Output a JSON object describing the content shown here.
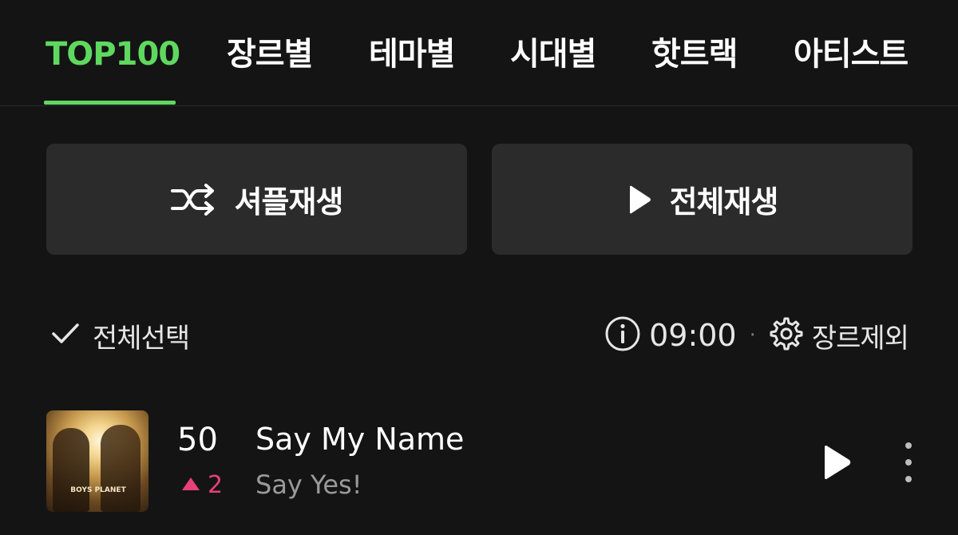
{
  "tabs": [
    {
      "label": "TOP100",
      "active": true
    },
    {
      "label": "장르별",
      "active": false
    },
    {
      "label": "테마별",
      "active": false
    },
    {
      "label": "시대별",
      "active": false
    },
    {
      "label": "핫트랙",
      "active": false
    },
    {
      "label": "아티스트",
      "active": false
    }
  ],
  "actions": {
    "shuffle_label": "셔플재생",
    "play_all_label": "전체재생"
  },
  "list_controls": {
    "select_all_label": "전체선택",
    "time": "09:00",
    "separator": "·",
    "genre_exclude_label": "장르제외"
  },
  "tracks": [
    {
      "rank": "50",
      "rank_change": "2",
      "rank_change_direction": "up",
      "title": "Say My Name",
      "artist": "Say Yes!",
      "cover_text": "BOYS PLANET"
    }
  ],
  "colors": {
    "background": "#141414",
    "accent": "#5fd85f",
    "button_bg": "#2b2b2b",
    "rank_up": "#e8407a",
    "secondary_text": "#9a9a9a"
  },
  "icons": {
    "shuffle": "shuffle-icon",
    "play": "play-icon",
    "check": "check-icon",
    "info": "info-icon",
    "gear": "gear-icon",
    "more": "more-vertical-icon",
    "rank_up": "triangle-up-icon"
  }
}
